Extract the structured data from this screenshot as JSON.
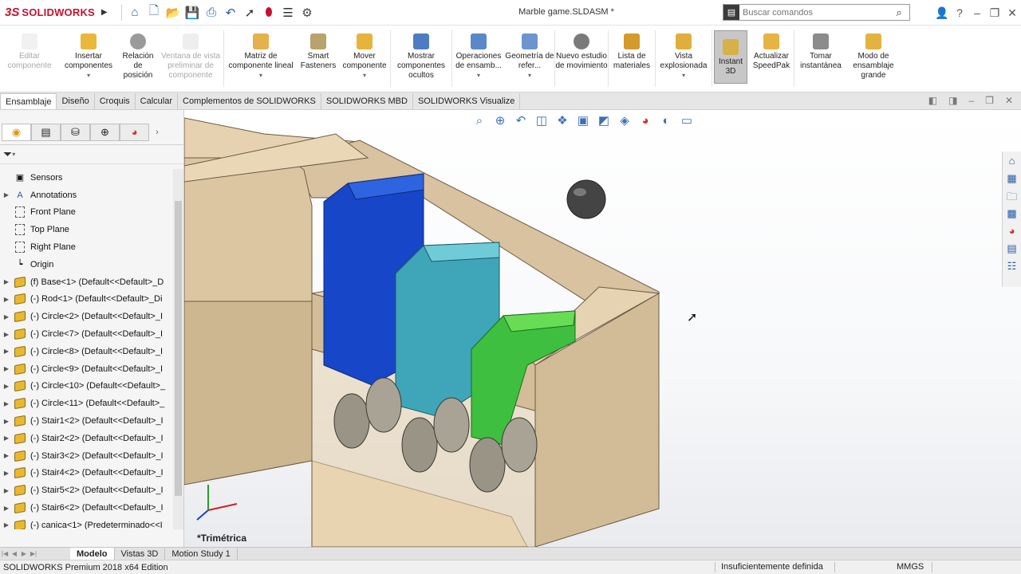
{
  "app": {
    "brand_ds": "3S",
    "brand_name": "SOLIDWORKS",
    "document_title": "Marble game.SLDASM *"
  },
  "search": {
    "placeholder": "Buscar comandos"
  },
  "ribbon": {
    "items": [
      {
        "label": "Editar componente",
        "disabled": true
      },
      {
        "label": "Insertar componentes",
        "disabled": false
      },
      {
        "label": "Relación de posición",
        "disabled": false
      },
      {
        "label": "Ventana de vista preliminar de componente",
        "disabled": true
      },
      {
        "label": "Matriz de componente lineal",
        "disabled": false
      },
      {
        "label": "Smart Fasteners",
        "disabled": false
      },
      {
        "label": "Mover componente",
        "disabled": false
      },
      {
        "label": "Mostrar componentes ocultos",
        "disabled": false
      },
      {
        "label": "Operaciones de ensamb...",
        "disabled": false
      },
      {
        "label": "Geometría de refer...",
        "disabled": false
      },
      {
        "label": "Nuevo estudio de movimiento",
        "disabled": false
      },
      {
        "label": "Lista de materiales",
        "disabled": false
      },
      {
        "label": "Vista explosionada",
        "disabled": false
      },
      {
        "label": "Instant 3D",
        "disabled": false,
        "active": true
      },
      {
        "label": "Actualizar SpeedPak",
        "disabled": false
      },
      {
        "label": "Tomar instantánea",
        "disabled": false
      },
      {
        "label": "Modo de ensamblaje grande",
        "disabled": false
      }
    ]
  },
  "tabs": [
    {
      "label": "Ensamblaje",
      "active": true
    },
    {
      "label": "Diseño"
    },
    {
      "label": "Croquis"
    },
    {
      "label": "Calcular"
    },
    {
      "label": "Complementos de SOLIDWORKS"
    },
    {
      "label": "SOLIDWORKS MBD"
    },
    {
      "label": "SOLIDWORKS Visualize"
    }
  ],
  "tree": [
    {
      "label": "Sensors",
      "icon": "sensor-icon",
      "expand": false
    },
    {
      "label": "Annotations",
      "icon": "annotation-icon",
      "expand": true
    },
    {
      "label": "Front Plane",
      "icon": "plane-icon",
      "expand": false
    },
    {
      "label": "Top Plane",
      "icon": "plane-icon",
      "expand": false
    },
    {
      "label": "Right Plane",
      "icon": "plane-icon",
      "expand": false
    },
    {
      "label": "Origin",
      "icon": "origin-icon",
      "expand": false
    },
    {
      "label": "(f) Base<1> (Default<<Default>_D",
      "icon": "part-icon",
      "expand": true
    },
    {
      "label": "(-) Rod<1> (Default<<Default>_Di",
      "icon": "part-icon",
      "expand": true
    },
    {
      "label": "(-) Circle<2> (Default<<Default>_I",
      "icon": "part-icon",
      "expand": true
    },
    {
      "label": "(-) Circle<7> (Default<<Default>_I",
      "icon": "part-icon",
      "expand": true
    },
    {
      "label": "(-) Circle<8> (Default<<Default>_I",
      "icon": "part-icon",
      "expand": true
    },
    {
      "label": "(-) Circle<9> (Default<<Default>_I",
      "icon": "part-icon",
      "expand": true
    },
    {
      "label": "(-) Circle<10> (Default<<Default>_",
      "icon": "part-icon",
      "expand": true
    },
    {
      "label": "(-) Circle<11> (Default<<Default>_",
      "icon": "part-icon",
      "expand": true
    },
    {
      "label": "(-) Stair1<2> (Default<<Default>_I",
      "icon": "part-icon",
      "expand": true
    },
    {
      "label": "(-) Stair2<2> (Default<<Default>_I",
      "icon": "part-icon",
      "expand": true
    },
    {
      "label": "(-) Stair3<2> (Default<<Default>_I",
      "icon": "part-icon",
      "expand": true
    },
    {
      "label": "(-) Stair4<2> (Default<<Default>_I",
      "icon": "part-icon",
      "expand": true
    },
    {
      "label": "(-) Stair5<2> (Default<<Default>_I",
      "icon": "part-icon",
      "expand": true
    },
    {
      "label": "(-) Stair6<2> (Default<<Default>_I",
      "icon": "part-icon",
      "expand": true
    },
    {
      "label": "(-) canica<1> (Predeterminado<<I",
      "icon": "part-icon",
      "expand": true
    }
  ],
  "viewport": {
    "view_label": "*Trimétrica"
  },
  "bottom_tabs": [
    {
      "label": "Modelo",
      "active": true
    },
    {
      "label": "Vistas 3D"
    },
    {
      "label": "Motion Study 1"
    }
  ],
  "status": {
    "edition": "SOLIDWORKS Premium 2018 x64 Edition",
    "definition": "Insuficientemente definida",
    "units": "MMGS"
  },
  "colors": {
    "brand": "#c8102e",
    "wood": "#d9c3a0",
    "wood_dark": "#b59c78",
    "blue": "#1746c8",
    "teal": "#3ea6b8",
    "green": "#3fbf3f",
    "marble": "#444444"
  }
}
